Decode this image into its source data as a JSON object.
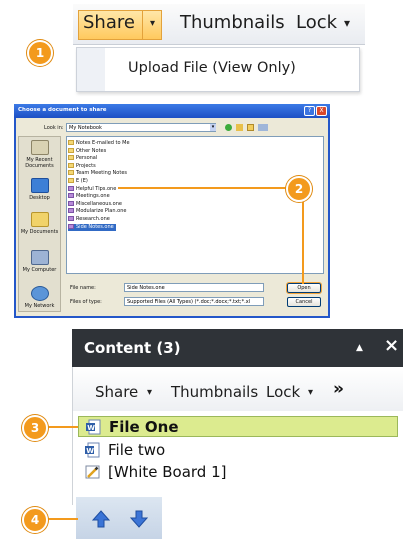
{
  "steps": [
    "1",
    "2",
    "3",
    "4"
  ],
  "panel1": {
    "share_label": "Share",
    "share_dropdown_glyph": "▾",
    "thumbnails_label": "Thumbnails",
    "lock_label": "Lock",
    "lock_dropdown_glyph": "▾",
    "menu_item": "Upload File (View Only)"
  },
  "dialog": {
    "title": "Choose a document to share",
    "look_in_label": "Look in:",
    "look_in_value": "My Notebook",
    "title_buttons": [
      "?",
      "X"
    ],
    "places": [
      {
        "label": "My Recent Documents",
        "icon": "recent-documents-icon"
      },
      {
        "label": "Desktop",
        "icon": "desktop-icon"
      },
      {
        "label": "My Documents",
        "icon": "my-documents-icon"
      },
      {
        "label": "My Computer",
        "icon": "my-computer-icon"
      },
      {
        "label": "My Network",
        "icon": "my-network-icon"
      }
    ],
    "files": [
      {
        "name": "Notes E-mailed to Me",
        "kind": "folder"
      },
      {
        "name": "Other Notes",
        "kind": "folder"
      },
      {
        "name": "Personal",
        "kind": "folder"
      },
      {
        "name": "Projects",
        "kind": "folder"
      },
      {
        "name": "Team Meeting Notes",
        "kind": "folder"
      },
      {
        "name": "E (E)",
        "kind": "folder"
      },
      {
        "name": "Helpful Tips.one",
        "kind": "onenote"
      },
      {
        "name": "Meetings.one",
        "kind": "onenote"
      },
      {
        "name": "Miscellaneous.one",
        "kind": "onenote"
      },
      {
        "name": "Modularize Plan.one",
        "kind": "onenote"
      },
      {
        "name": "Research.one",
        "kind": "onenote"
      },
      {
        "name": "Side Notes.one",
        "kind": "onenote",
        "selected": true
      }
    ],
    "file_name_label": "File name:",
    "file_name_value": "Side Notes.one",
    "files_of_type_label": "Files of type:",
    "files_of_type_value": "Supported Files (All Types) (*.doc;*.docx;*.txt;*.xl",
    "open_label": "Open",
    "cancel_label": "Cancel"
  },
  "panel3": {
    "title": "Content (3)",
    "share_label": "Share",
    "thumbnails_label": "Thumbnails",
    "lock_label": "Lock",
    "more_glyph": "»",
    "caret": "▾",
    "collapse_glyph": "▲",
    "close_glyph": "×",
    "items": [
      {
        "name": "File One",
        "icon": "word-document-icon",
        "selected": true
      },
      {
        "name": "File two",
        "icon": "word-document-icon",
        "selected": false
      },
      {
        "name": "[White Board 1]",
        "icon": "whiteboard-icon",
        "selected": false
      }
    ]
  },
  "panel4": {
    "up_icon": "arrow-up-icon",
    "down_icon": "arrow-down-icon"
  },
  "colors": {
    "step_badge": "#f39a1d",
    "selected_row": "#dceb8f",
    "content_header": "#2f3338",
    "dialog_title": "#1d4fc4"
  }
}
